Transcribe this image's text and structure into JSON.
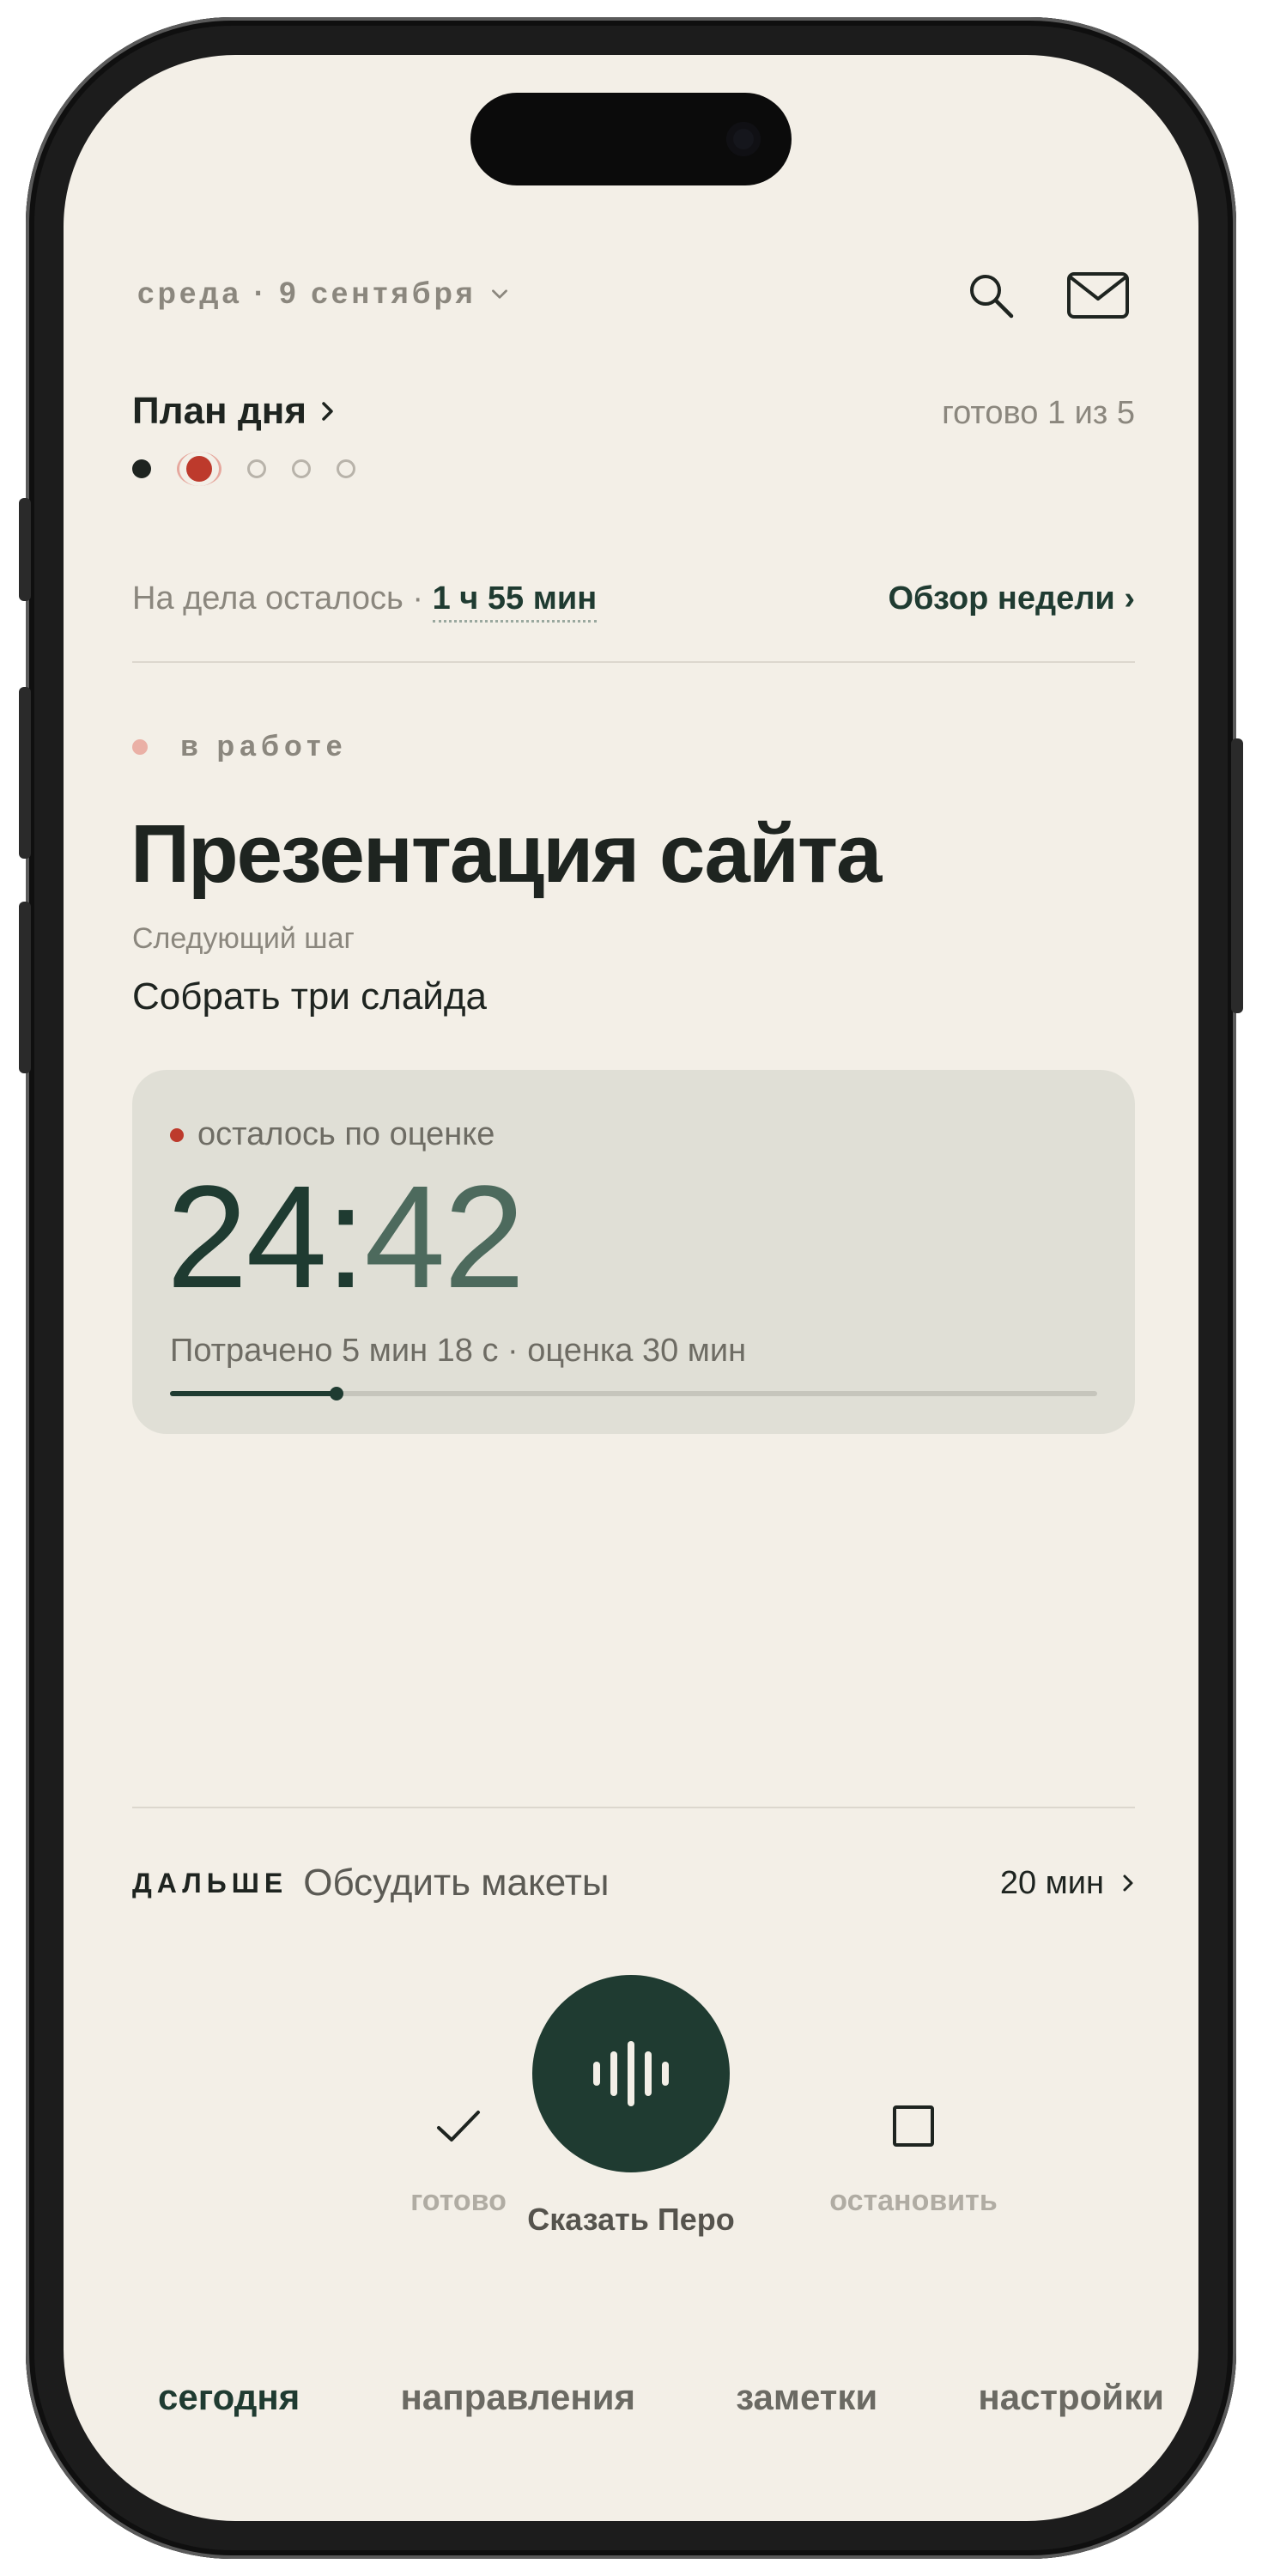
{
  "header": {
    "date": "среда · 9 сентября",
    "search_icon": "search-icon",
    "mail_icon": "mail-icon"
  },
  "plan": {
    "title": "План дня",
    "count": "готово 1 из 5",
    "steps_total": 5,
    "steps_done": 1,
    "current_step": 2
  },
  "remaining": {
    "label": "На дела осталось ·",
    "value": "1 ч 55 мин",
    "week_link": "Обзор недели ›"
  },
  "task": {
    "status": "в работе",
    "title": "Презентация сайта",
    "next_step_label": "Следующий шаг",
    "next_step": "Собрать три слайда"
  },
  "timer": {
    "label": "осталось по оценке",
    "minutes": "24",
    "colon": ":",
    "seconds": "42",
    "spent": "Потрачено 5 мин 18 с · оценка 30 мин",
    "progress_fraction": 0.18
  },
  "next": {
    "tag": "ДАЛЬШЕ",
    "task": "Обсудить макеты",
    "duration": "20 мин"
  },
  "actions": {
    "done_label": "готово",
    "speak_label": "Сказать Перо",
    "stop_label": "остановить"
  },
  "tabs": [
    {
      "label": "сегодня",
      "active": true
    },
    {
      "label": "направления",
      "active": false
    },
    {
      "label": "заметки",
      "active": false
    },
    {
      "label": "настройки",
      "active": false
    }
  ],
  "colors": {
    "background": "#f3efe7",
    "accent": "#1f3b31",
    "active_dot": "#bd3a2c",
    "card": "#e0dfd6"
  }
}
